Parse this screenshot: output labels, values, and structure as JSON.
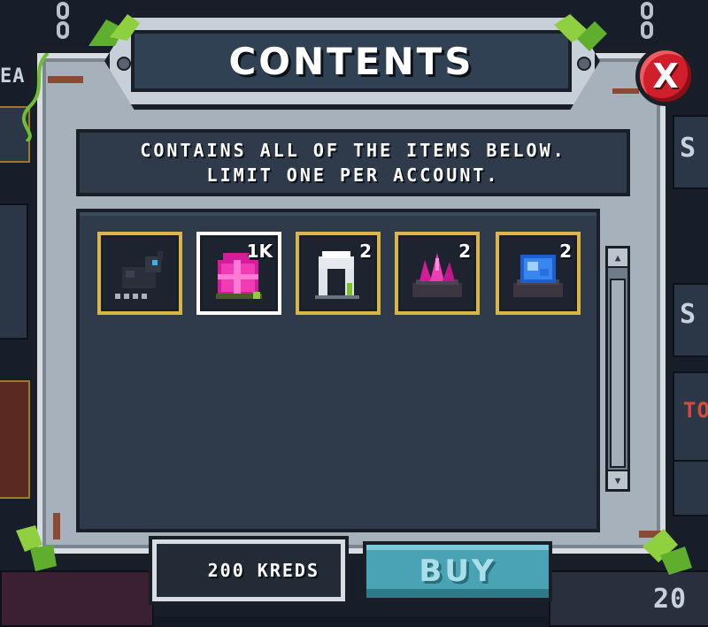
{
  "dialog": {
    "title": "CONTENTS",
    "close_label": "X",
    "description": [
      "CONTAINS ALL OF THE ITEMS BELOW.",
      "LIMIT ONE PER ACCOUNT."
    ]
  },
  "items": [
    {
      "icon": "dark-mount-icon",
      "count": "",
      "selected": false
    },
    {
      "icon": "pink-gift-box-icon",
      "count": "1K",
      "selected": true
    },
    {
      "icon": "white-door-gate-icon",
      "count": "2",
      "selected": false
    },
    {
      "icon": "pink-crystal-icon",
      "count": "2",
      "selected": false
    },
    {
      "icon": "blue-crystal-icon",
      "count": "2",
      "selected": false
    }
  ],
  "footer": {
    "price": "200 KREDS",
    "buy_label": "BUY"
  },
  "background": {
    "side_texts": [
      "S",
      "S",
      "TO",
      "20",
      "EA"
    ]
  },
  "colors": {
    "panel": "#2f3b4a",
    "frame": "#a7b1bb",
    "gold_border": "#d9b646",
    "close_red": "#d01e2a",
    "buy_teal": "#4aa3b4"
  }
}
